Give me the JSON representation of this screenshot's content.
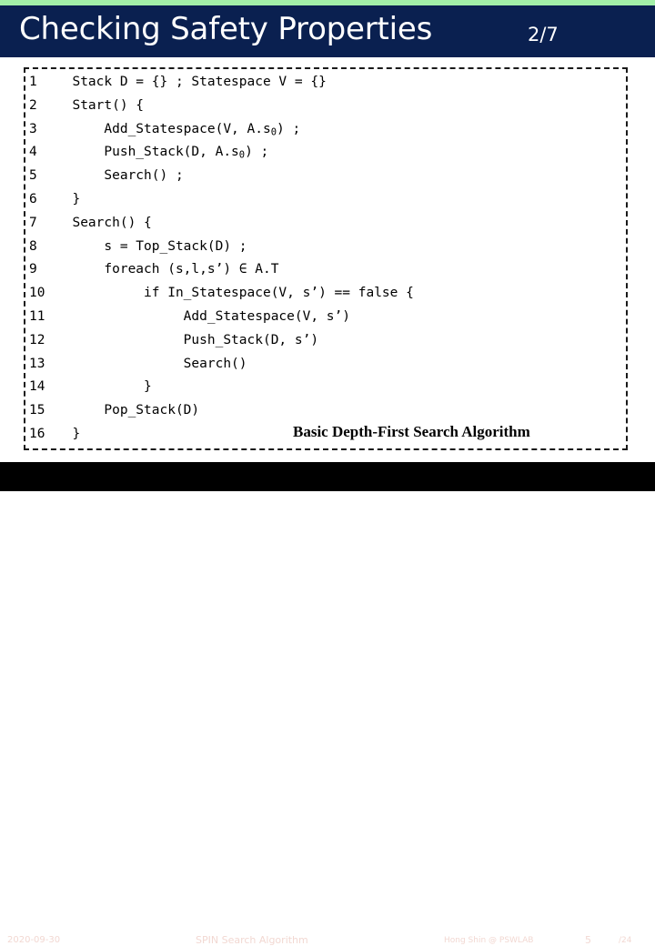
{
  "accent_color": "#a2f0a8",
  "title_bar_color": "#0a2050",
  "footer_bar_color": "#000000",
  "footer_text_color": "#f2d8d2",
  "header": {
    "title": "Checking Safety Properties",
    "step_counter": "2/7"
  },
  "code": {
    "caption": "Basic Depth-First Search Algorithm",
    "lines": [
      {
        "num": "1",
        "pre": "  Stack D = {} ; Statespace V = {}",
        "sub": "",
        "post": ""
      },
      {
        "num": "2",
        "pre": "  Start() {",
        "sub": "",
        "post": ""
      },
      {
        "num": "3",
        "pre": "      Add_Statespace(V, A.s",
        "sub": "0",
        "post": ") ;"
      },
      {
        "num": "4",
        "pre": "      Push_Stack(D, A.s",
        "sub": "0",
        "post": ") ;"
      },
      {
        "num": "5",
        "pre": "      Search() ;",
        "sub": "",
        "post": ""
      },
      {
        "num": "6",
        "pre": "  }",
        "sub": "",
        "post": ""
      },
      {
        "num": "7",
        "pre": "  Search() {",
        "sub": "",
        "post": ""
      },
      {
        "num": "8",
        "pre": "      s = Top_Stack(D) ;",
        "sub": "",
        "post": ""
      },
      {
        "num": "9",
        "pre": "      foreach (s,l,s’) ∈ A.T",
        "sub": "",
        "post": ""
      },
      {
        "num": "10",
        "pre": "           if In_Statespace(V, s’) == false {",
        "sub": "",
        "post": ""
      },
      {
        "num": "11",
        "pre": "                Add_Statespace(V, s’)",
        "sub": "",
        "post": ""
      },
      {
        "num": "12",
        "pre": "                Push_Stack(D, s’)",
        "sub": "",
        "post": ""
      },
      {
        "num": "13",
        "pre": "                Search()",
        "sub": "",
        "post": ""
      },
      {
        "num": "14",
        "pre": "           }",
        "sub": "",
        "post": ""
      },
      {
        "num": "15",
        "pre": "      Pop_Stack(D)",
        "sub": "",
        "post": ""
      },
      {
        "num": "16",
        "pre": "  }",
        "sub": "",
        "post": ""
      }
    ]
  },
  "footer": {
    "date": "2020-09-30",
    "center": "SPIN Search Algorithm",
    "author": "Hong Shin @ PSWLAB",
    "page": "5",
    "total": "/24"
  }
}
